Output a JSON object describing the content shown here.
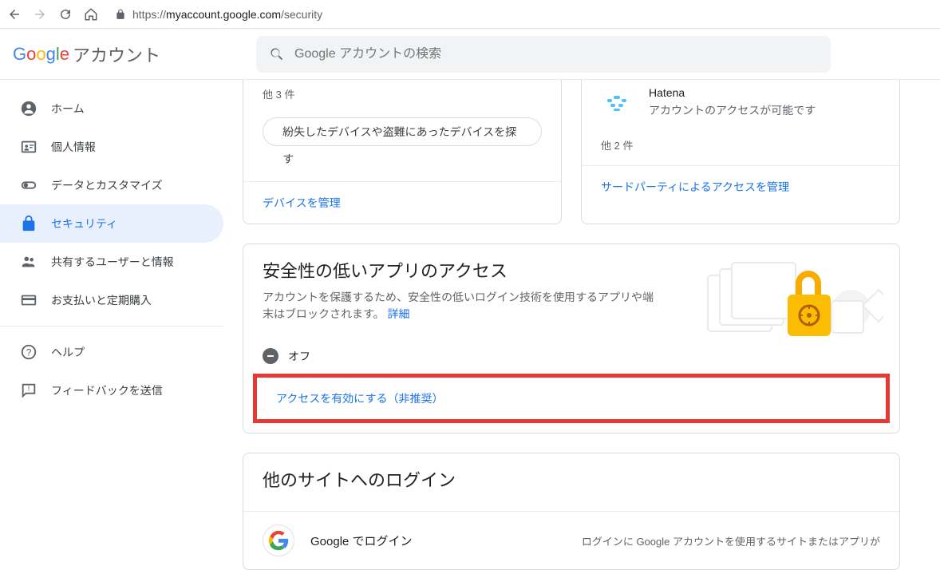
{
  "browser": {
    "url_protocol": "https://",
    "url_host": "myaccount.google.com",
    "url_path": "/security"
  },
  "header": {
    "logo_suffix": "アカウント",
    "search_placeholder": "Google アカウントの検索"
  },
  "sidebar": {
    "items": [
      {
        "label": "ホーム"
      },
      {
        "label": "個人情報"
      },
      {
        "label": "データとカスタマイズ"
      },
      {
        "label": "セキュリティ"
      },
      {
        "label": "共有するユーザーと情報"
      },
      {
        "label": "お支払いと定期購入"
      }
    ],
    "help": "ヘルプ",
    "feedback": "フィードバックを送信"
  },
  "devices_card": {
    "other_count": "他 3 件",
    "find_device": "紛失したデバイスや盗難にあったデバイスを探す",
    "manage": "デバイスを管理"
  },
  "thirdparty_card": {
    "app_name": "Hatena",
    "app_sub": "アカウントのアクセスが可能です",
    "other_count": "他 2 件",
    "manage": "サードパーティによるアクセスを管理"
  },
  "lowsec_card": {
    "title": "安全性の低いアプリのアクセス",
    "desc": "アカウントを保護するため、安全性の低いログイン技術を使用するアプリや端末はブロックされます。 ",
    "details": "詳細",
    "status": "オフ",
    "enable": "アクセスを有効にする（非推奨）"
  },
  "signin_card": {
    "title": "他のサイトへのログイン",
    "google_signin": "Google でログイン",
    "right_text": "ログインに Google アカウントを使用するサイトまたはアプリが"
  }
}
